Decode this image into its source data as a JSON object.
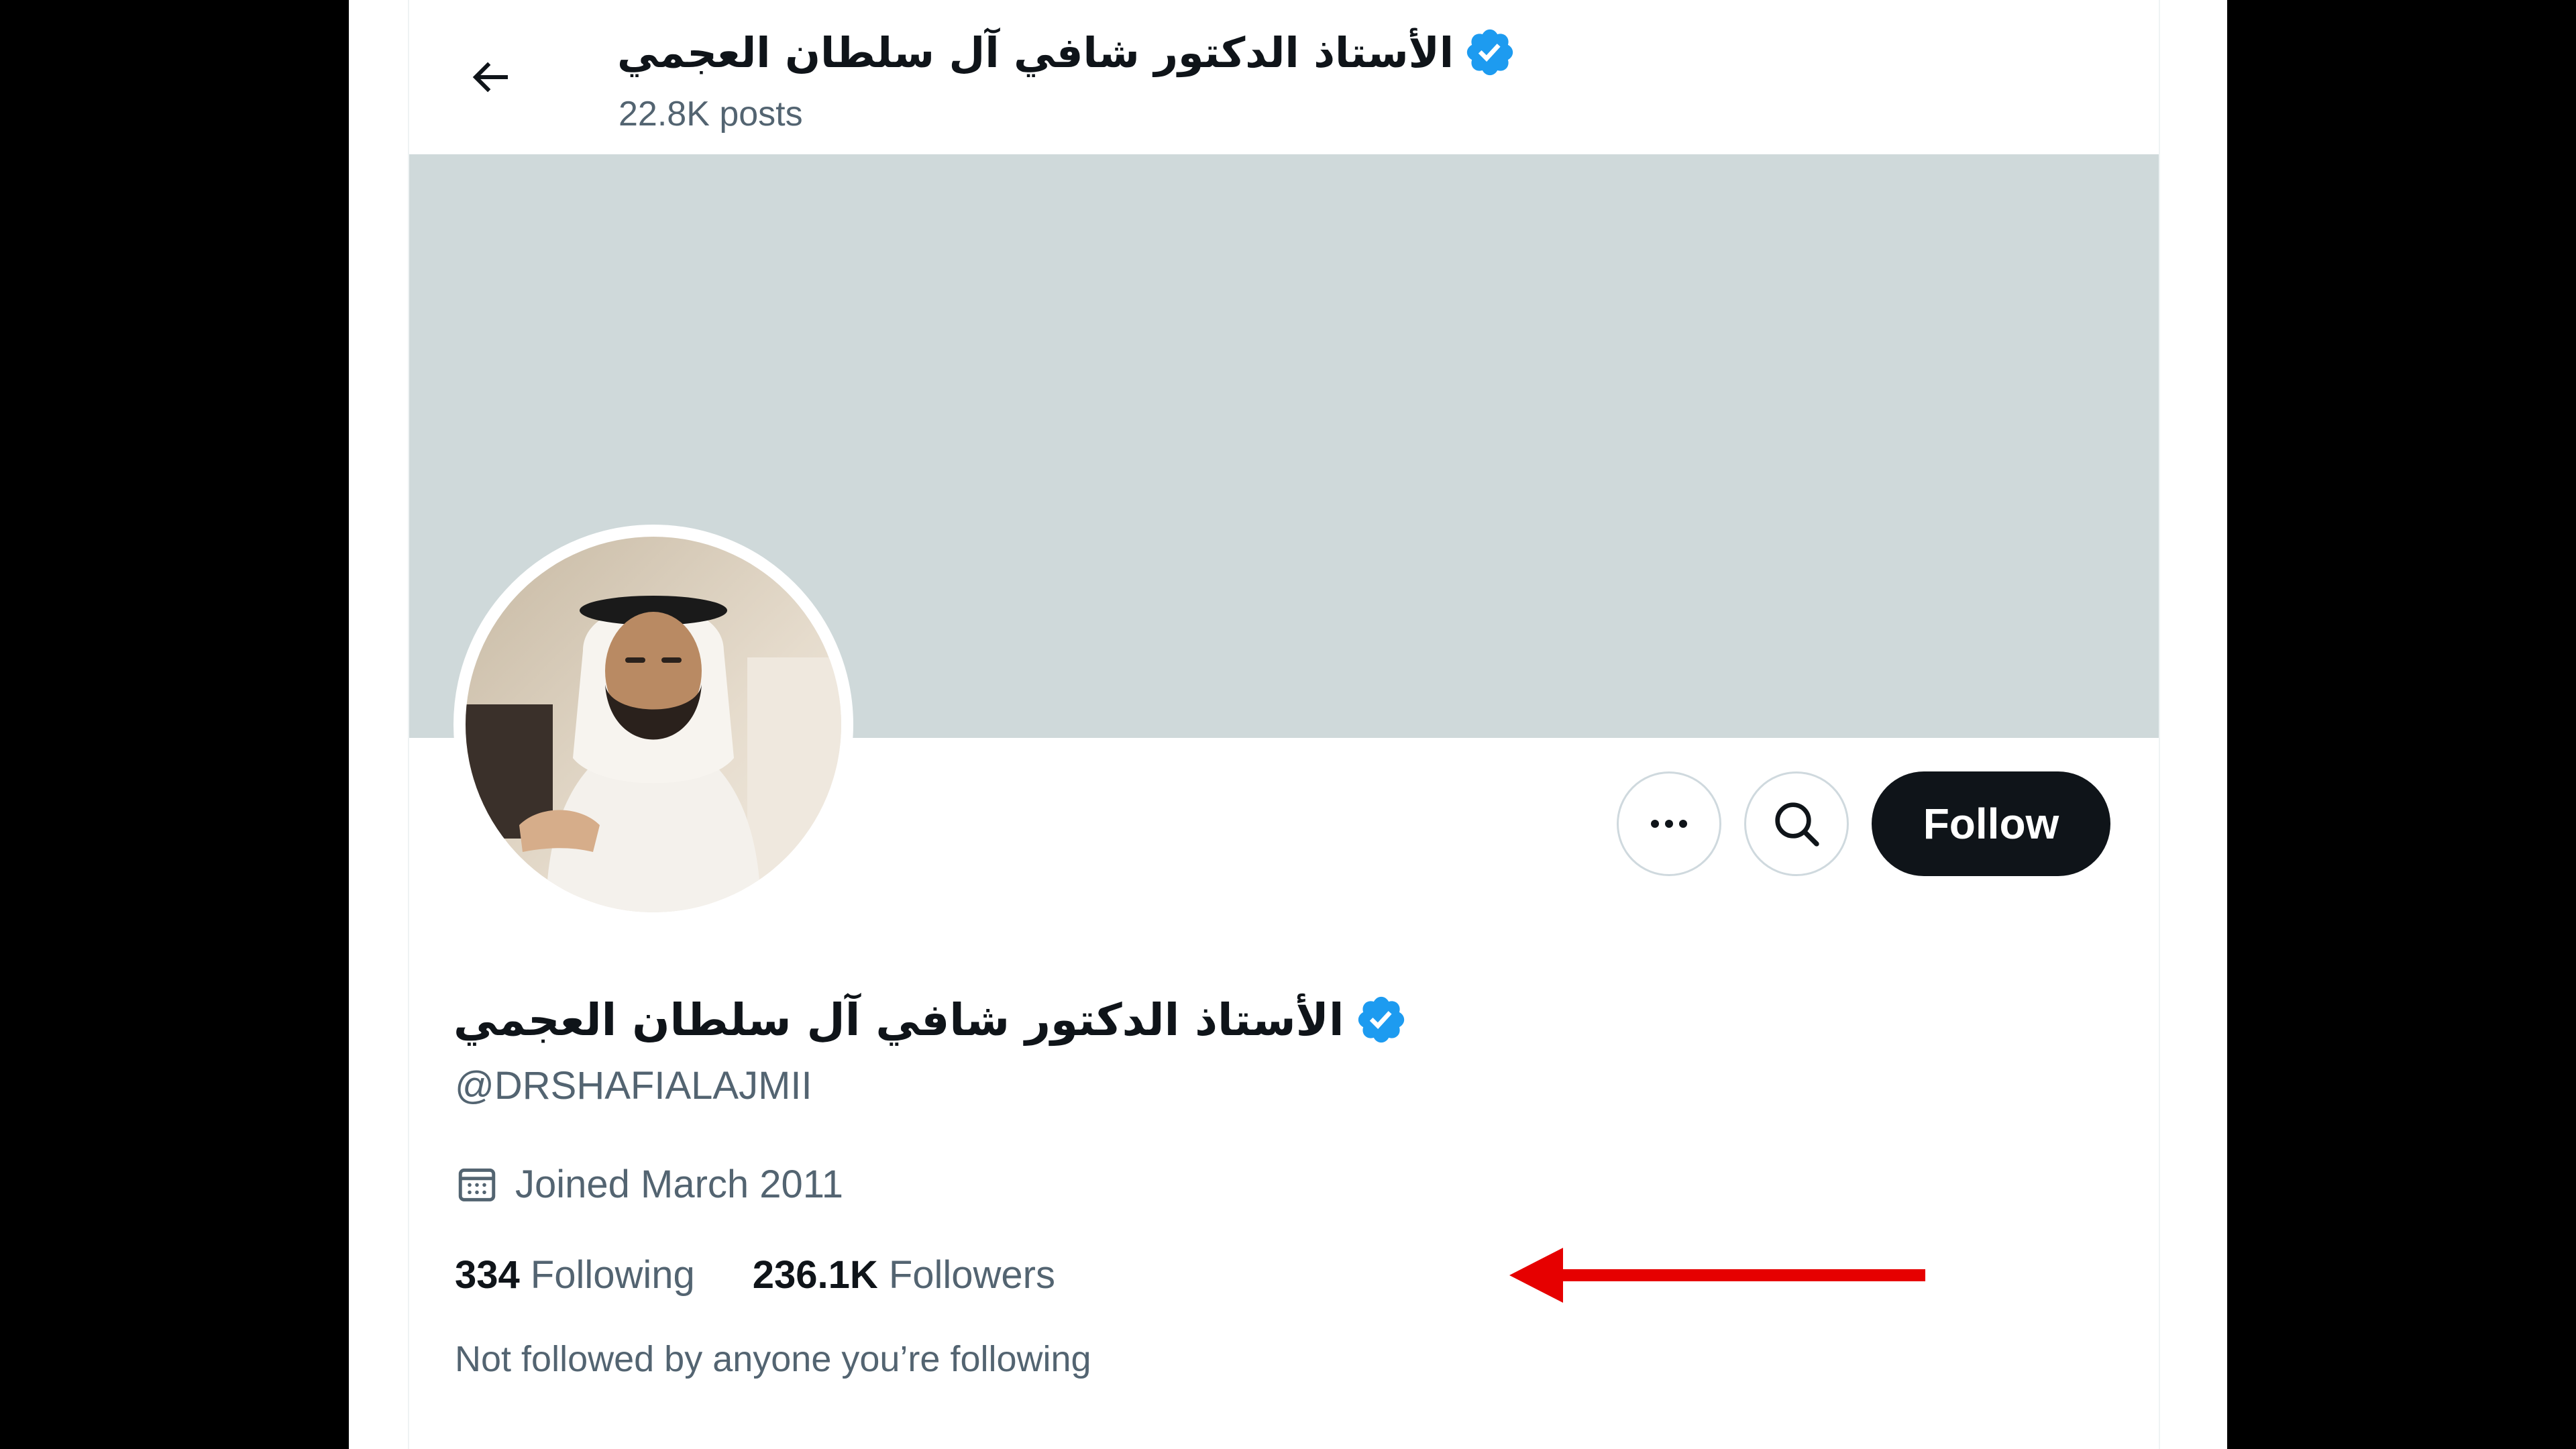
{
  "header": {
    "name": "الأستاذ الدكتور شافي آل سلطان العجمي",
    "posts": "22.8K posts"
  },
  "actions": {
    "more_icon": "more-horizontal-icon",
    "search_icon": "search-icon",
    "follow_label": "Follow"
  },
  "profile": {
    "name": "الأستاذ الدكتور شافي آل سلطان العجمي",
    "handle": "@DRSHAFIALAJMII",
    "joined": "Joined March 2011",
    "following_count": "334",
    "following_label": "Following",
    "followers_count": "236.1K",
    "followers_label": "Followers",
    "not_followed": "Not followed by anyone you’re following"
  },
  "colors": {
    "banner": "#cfd9da",
    "verified": "#1d9bf0",
    "annotation_arrow": "#e60000"
  }
}
